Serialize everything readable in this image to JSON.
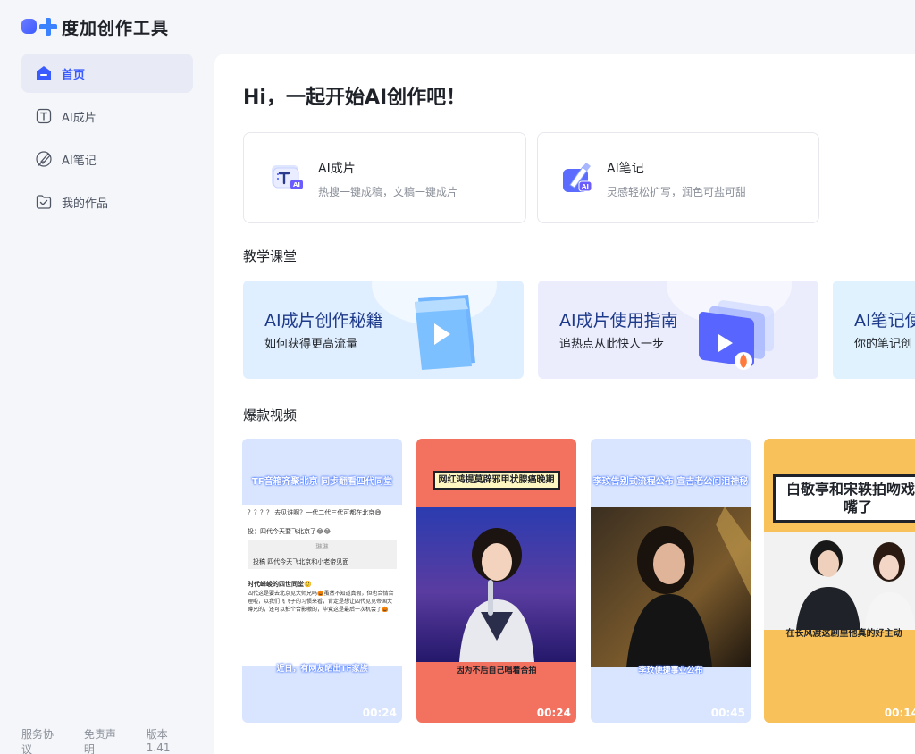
{
  "brand": {
    "name": "度加创作工具"
  },
  "nav": {
    "items": [
      {
        "label": "首页",
        "icon": "home-icon",
        "active": true
      },
      {
        "label": "AI成片",
        "icon": "text-t-icon"
      },
      {
        "label": "AI笔记",
        "icon": "pen-icon"
      },
      {
        "label": "我的作品",
        "icon": "folder-check-icon"
      }
    ]
  },
  "footer": {
    "terms": "服务协议",
    "disclaimer": "免责声明",
    "version": "版本 1.41"
  },
  "main": {
    "greeting": "Hi，一起开始AI创作吧！",
    "features": [
      {
        "title": "AI成片",
        "desc": "热搜一键成稿，文稿一键成片",
        "icon": "ai-video-icon"
      },
      {
        "title": "AI笔记",
        "desc": "灵感轻松扩写，润色可盐可甜",
        "icon": "ai-note-icon"
      }
    ],
    "tutorial_section": "教学课堂",
    "tutorials": [
      {
        "title": "AI成片创作秘籍",
        "subtitle": "如何获得更高流量",
        "icon": "play-cube-icon",
        "bg": "#e0efff"
      },
      {
        "title": "AI成片使用指南",
        "subtitle": "追热点从此快人一步",
        "icon": "play-window-icon",
        "bg": "#ebedfd"
      },
      {
        "title": "AI笔记使",
        "subtitle": "你的笔记创",
        "icon": "note-icon",
        "bg": "#dff2fd"
      }
    ],
    "video_section": "爆款视频",
    "videos": [
      {
        "top_caption": "TF音箱齐聚北京 同步翻看四代同堂",
        "bottom_caption": "近日，有网友晒出TF家族",
        "duration": "00:24",
        "bg": "#d9e5ff"
      },
      {
        "top_caption": "网红鸿提莫辟邪甲状腺癌晚期",
        "bottom_caption": "因为不后自己唱着合拍",
        "duration": "00:24",
        "bg": "#f2715f"
      },
      {
        "top_caption": "李玟告别式流程公布 宣吉老公问泪神秘",
        "bottom_caption": "李玟便捷事业公布",
        "duration": "00:45",
        "bg": "#d9e5ff"
      },
      {
        "top_caption": "白敬亭和宋轶拍吻戏张嘴了",
        "bottom_caption": "在长风渡这剧里他真的好主动",
        "duration": "00:14",
        "bg": "#f8c15a"
      }
    ],
    "post_snippets": {
      "line1": "？？？？ 去见谁啊？一代二代三代可都在北京😅",
      "line2": "投：四代今天要飞北京了😂😂",
      "reply_name": "琳琳",
      "reply_text": "投稿 四代今天飞北京和小老帝见面",
      "line3": "时代峰峻的四世同堂🙂",
      "line4": "四代这是要去北京见大师兄吗🎃虽然不知道真假，但也合情合理啦，以我们飞飞子的习惯来看，肯定是想让四代见见帝国大蹲兄的，还可以拍个合影嗷的，毕竟这是最后一次机会了🎃"
    }
  }
}
